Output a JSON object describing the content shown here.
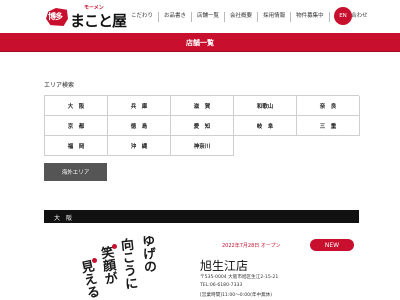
{
  "header": {
    "logo_small": "モーメン",
    "logo_seal": "博多",
    "logo_name": "まこと屋",
    "nav": [
      "こだわり",
      "お品書き",
      "店舗一覧",
      "会社概要",
      "採用情報",
      "物件募集中",
      "お問い合わせ"
    ],
    "lang_button": "EN"
  },
  "banner": {
    "title": "店舗一覧"
  },
  "area_search": {
    "title": "エリア検索",
    "areas": [
      "大　阪",
      "兵　庫",
      "滋　賀",
      "和歌山",
      "奈　良",
      "京　都",
      "徳　島",
      "愛　知",
      "岐　阜",
      "三　重",
      "福　岡",
      "沖　縄",
      "神奈川"
    ],
    "overseas_button": "海外エリア"
  },
  "region": {
    "label": "大　阪"
  },
  "store": {
    "image_text": [
      "見える",
      "笑顔が",
      "向こうに",
      "ゆげの"
    ],
    "open_date": "2022年7月28日 オープン",
    "badge": "NEW",
    "name": "旭生江店",
    "address": "〒535-0004 大阪市旭区生江2-15-21",
    "tel": "TEL:06-6180-7333",
    "hours": "[営業時間]11:00～0:00(年中無休)"
  },
  "colors": {
    "brand_red": "#c8102e",
    "dark": "#111111",
    "overseas_gray": "#555555"
  }
}
